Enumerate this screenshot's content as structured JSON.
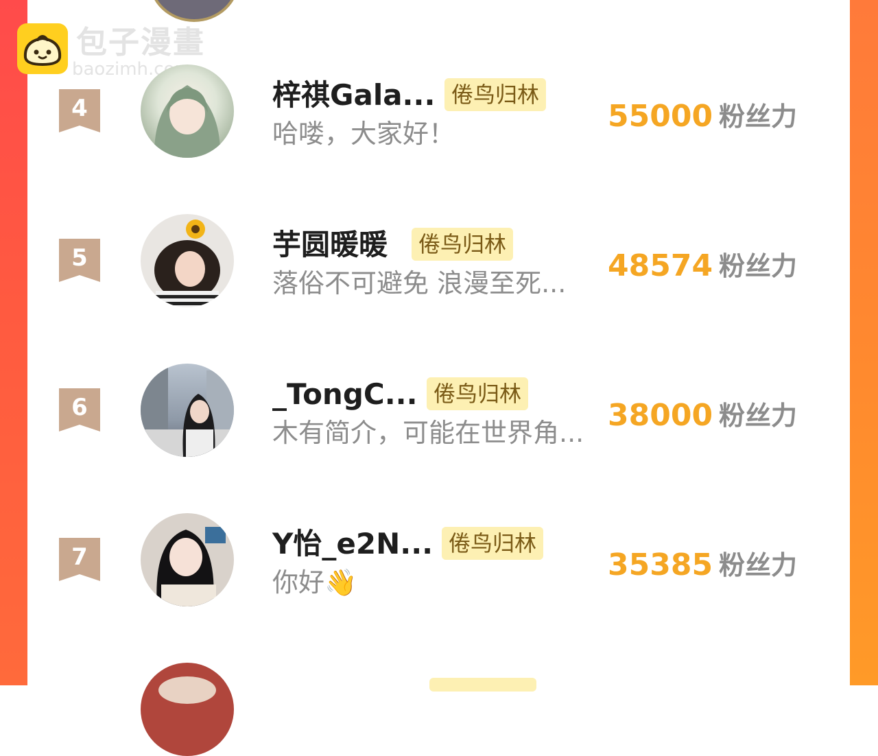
{
  "watermark": {
    "title": "包子漫畫",
    "site": "baozimh.com"
  },
  "colors": {
    "accent_score": "#f5a623",
    "tag_bg": "#fdf0b3",
    "rank_badge": "#c9a88f",
    "edge_left": "#ff4b4b",
    "edge_right": "#ff8a2e"
  },
  "ranking": {
    "items": [
      {
        "rank": "4",
        "name": "梓祺Gala...",
        "tag": "倦鸟归林",
        "bio": "哈喽，大家好！",
        "score": "55000",
        "unit": "粉丝力",
        "avatar": "avatar-anime-girl"
      },
      {
        "rank": "5",
        "name": "芋圆暖暖",
        "tag": "倦鸟归林",
        "bio": "落俗不可避免 浪漫至死...",
        "score": "48574",
        "unit": "粉丝力",
        "avatar": "avatar-sunflower-girl"
      },
      {
        "rank": "6",
        "name": "_TongC...",
        "tag": "倦鸟归林",
        "bio": "木有简介，可能在世界角...",
        "score": "38000",
        "unit": "粉丝力",
        "avatar": "avatar-street-girl"
      },
      {
        "rank": "7",
        "name": "Y怡_e2N...",
        "tag": "倦鸟归林",
        "bio": "你好👋",
        "score": "35385",
        "unit": "粉丝力",
        "avatar": "avatar-cafe-girl"
      }
    ]
  }
}
